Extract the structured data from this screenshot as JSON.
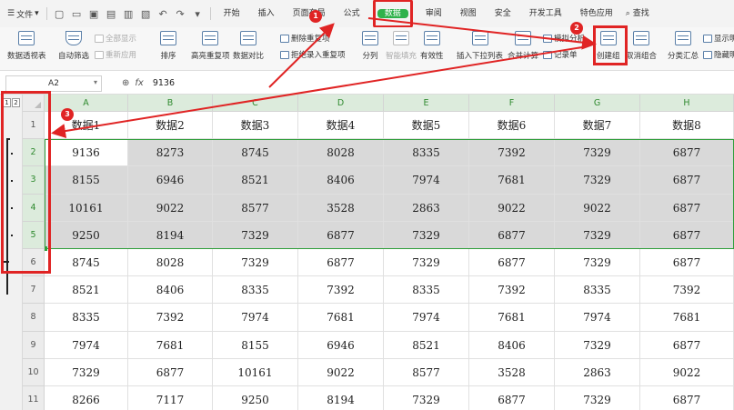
{
  "menubar": {
    "file_label": "文件",
    "tabs": [
      "开始",
      "插入",
      "页面布局",
      "公式",
      "数据",
      "审阅",
      "视图",
      "安全",
      "开发工具",
      "特色应用"
    ],
    "active_tab": "数据",
    "search_label": "查找"
  },
  "ribbon": {
    "pivot": "数据透视表",
    "autofilter": "自动筛选",
    "show_all": "全部显示",
    "reapply": "重新应用",
    "sort": "排序",
    "highlight_dup": "高亮重复项",
    "compare": "数据对比",
    "delete_dup": "删除重复项",
    "reject_dup": "拒绝录入重复项",
    "split": "分列",
    "smart_fill": "智能填充",
    "validity": "有效性",
    "insert_dropdown": "插入下拉列表",
    "merge_calc": "合并计算",
    "simulate": "模拟分析",
    "record": "记录单",
    "create_group": "创建组",
    "ungroup": "取消组合",
    "subtotal": "分类汇总",
    "show_detail": "显示明细",
    "hide_detail": "隐藏明细"
  },
  "formula_bar": {
    "cell_ref": "A2",
    "fx": "fx",
    "value": "9136"
  },
  "outline": {
    "levels": [
      "1",
      "2"
    ]
  },
  "sheet": {
    "columns": [
      "A",
      "B",
      "C",
      "D",
      "E",
      "F",
      "G",
      "H"
    ],
    "row_numbers": [
      "1",
      "2",
      "3",
      "4",
      "5",
      "6",
      "7",
      "8",
      "9",
      "10",
      "11"
    ],
    "rows": [
      [
        "数据1",
        "数据2",
        "数据3",
        "数据4",
        "数据5",
        "数据6",
        "数据7",
        "数据8"
      ],
      [
        "9136",
        "8273",
        "8745",
        "8028",
        "8335",
        "7392",
        "7329",
        "6877"
      ],
      [
        "8155",
        "6946",
        "8521",
        "8406",
        "7974",
        "7681",
        "7329",
        "6877"
      ],
      [
        "10161",
        "9022",
        "8577",
        "3528",
        "2863",
        "9022",
        "9022",
        "6877"
      ],
      [
        "9250",
        "8194",
        "7329",
        "6877",
        "7329",
        "6877",
        "7329",
        "6877"
      ],
      [
        "8745",
        "8028",
        "7329",
        "6877",
        "7329",
        "6877",
        "7329",
        "6877"
      ],
      [
        "8521",
        "8406",
        "8335",
        "7392",
        "8335",
        "7392",
        "8335",
        "7392"
      ],
      [
        "8335",
        "7392",
        "7974",
        "7681",
        "7974",
        "7681",
        "7974",
        "7681"
      ],
      [
        "7974",
        "7681",
        "8155",
        "6946",
        "8521",
        "8406",
        "7329",
        "6877"
      ],
      [
        "7329",
        "6877",
        "10161",
        "9022",
        "8577",
        "3528",
        "2863",
        "9022"
      ],
      [
        "8266",
        "7117",
        "9250",
        "8194",
        "7329",
        "6877",
        "7329",
        "6877"
      ]
    ]
  },
  "annotations": {
    "badges": [
      "1",
      "2",
      "3"
    ]
  },
  "colors": {
    "accent": "#2eb24b",
    "selection": "#2e9e3a",
    "annotation": "#e02424"
  }
}
